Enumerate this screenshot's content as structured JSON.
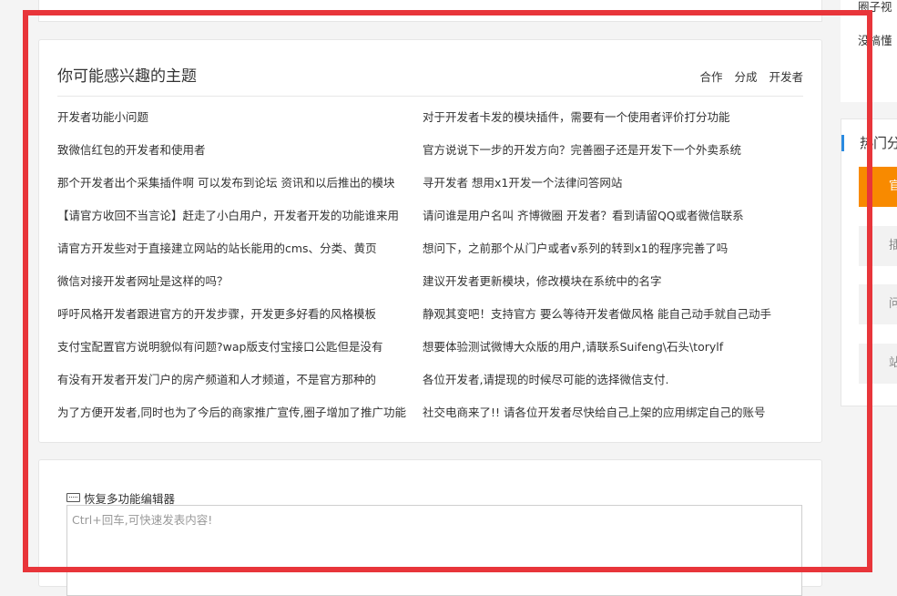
{
  "topics_card": {
    "title": "你可能感兴趣的主题",
    "tags": [
      "合作",
      "分成",
      "开发者"
    ],
    "items": [
      "开发者功能小问题",
      "对于开发者卡发的模块插件，需要有一个使用者评价打分功能",
      "致微信红包的开发者和使用者",
      "官方说说下一步的开发方向？完善圈子还是开发下一个外卖系统",
      "那个开发者出个采集插件啊 可以发布到论坛 资讯和以后推出的模块",
      "寻开发者 想用x1开发一个法律问答网站",
      "【请官方收回不当言论】赶走了小白用户，开发者开发的功能谁来用",
      "请问谁是用户名叫 齐博微圈 开发者？看到请留QQ或者微信联系",
      "请官方开发些对于直接建立网站的站长能用的cms、分类、黄页",
      "想问下，之前那个从门户或者v系列的转到x1的程序完善了吗",
      "微信对接开发者网址是这样的吗？",
      "建议开发者更新模块，修改模块在系统中的名字",
      "呼吁风格开发者跟进官方的开发步骤，开发更多好看的风格模板",
      "静观其变吧！支持官方 要么等待开发者做风格 能自己动手就自己动手",
      "支付宝配置官方说明貌似有问题?wap版支付宝接口公匙但是没有",
      "想要体验测试微博大众版的用户,请联系Suifeng\\石头\\torylf",
      "有没有开发者开发门户的房产频道和人才频道，不是官方那种的",
      "各位开发者,请提现的时候尽可能的选择微信支付.",
      "为了方便开发者,同时也为了今后的商家推广宣传,圈子增加了推广功能",
      "社交电商来了!! 请各位开发者尽快给自己上架的应用绑定自己的账号"
    ]
  },
  "editor": {
    "label": "恢复多功能编辑器",
    "placeholder": "Ctrl+回车,可快速发表内容!"
  },
  "right_top": {
    "line1": "圈子视",
    "line2": "没搞懂"
  },
  "right_panel": {
    "title": "热门分",
    "buttons": [
      "官",
      "插",
      "问",
      "站"
    ]
  },
  "colors": {
    "accent_blue": "#2a8ae0",
    "accent_orange": "#f88a00",
    "highlight_frame": "#e8353a"
  }
}
